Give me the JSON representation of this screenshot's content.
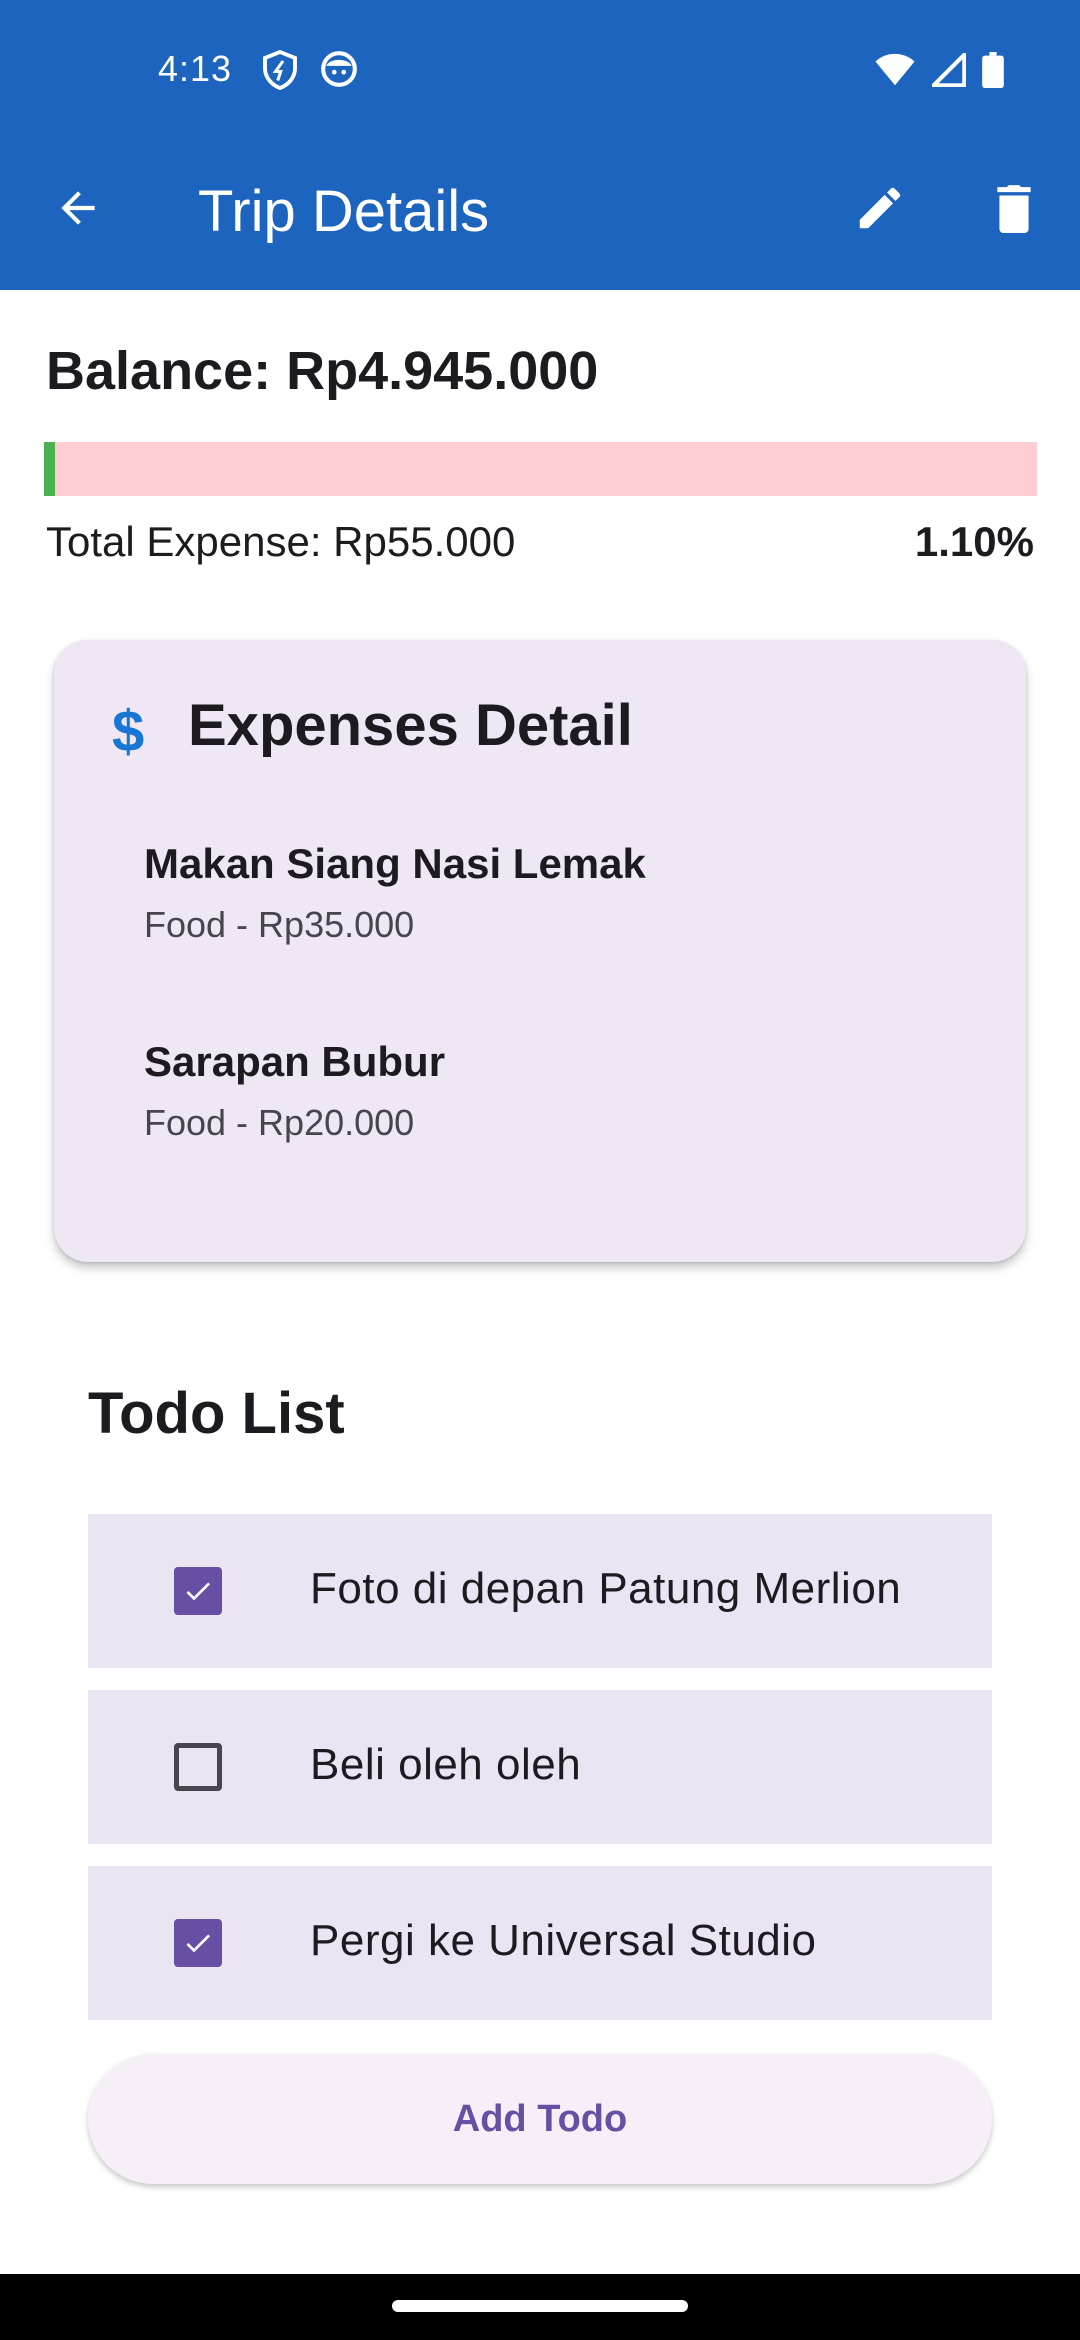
{
  "status_bar": {
    "time": "4:13",
    "left_icons": [
      "shield-icon",
      "face-icon"
    ],
    "right_icons": [
      "wifi-icon",
      "signal-icon",
      "battery-icon"
    ]
  },
  "app_bar": {
    "title": "Trip Details",
    "back_icon": "arrow-back-icon",
    "actions": [
      "edit-icon",
      "delete-icon"
    ],
    "color": "#1c64be"
  },
  "summary": {
    "balance": "Balance: Rp4.945.000",
    "total_expense": "Total Expense: Rp55.000",
    "percent": "1.10%",
    "progress_fraction": 0.011,
    "progress_fill_color": "#4caf50",
    "progress_track_color": "#ffcdd2"
  },
  "expenses": {
    "icon": "$",
    "title": "Expenses Detail",
    "items": [
      {
        "name": "Makan Siang Nasi Lemak",
        "detail": "Food - Rp35.000"
      },
      {
        "name": "Sarapan Bubur",
        "detail": "Food - Rp20.000"
      }
    ]
  },
  "todos": {
    "title": "Todo List",
    "items": [
      {
        "label": "Foto di depan Patung Merlion",
        "checked": true
      },
      {
        "label": "Beli oleh oleh",
        "checked": false
      },
      {
        "label": "Pergi ke Universal Studio",
        "checked": true
      }
    ],
    "add_label": "Add Todo"
  }
}
